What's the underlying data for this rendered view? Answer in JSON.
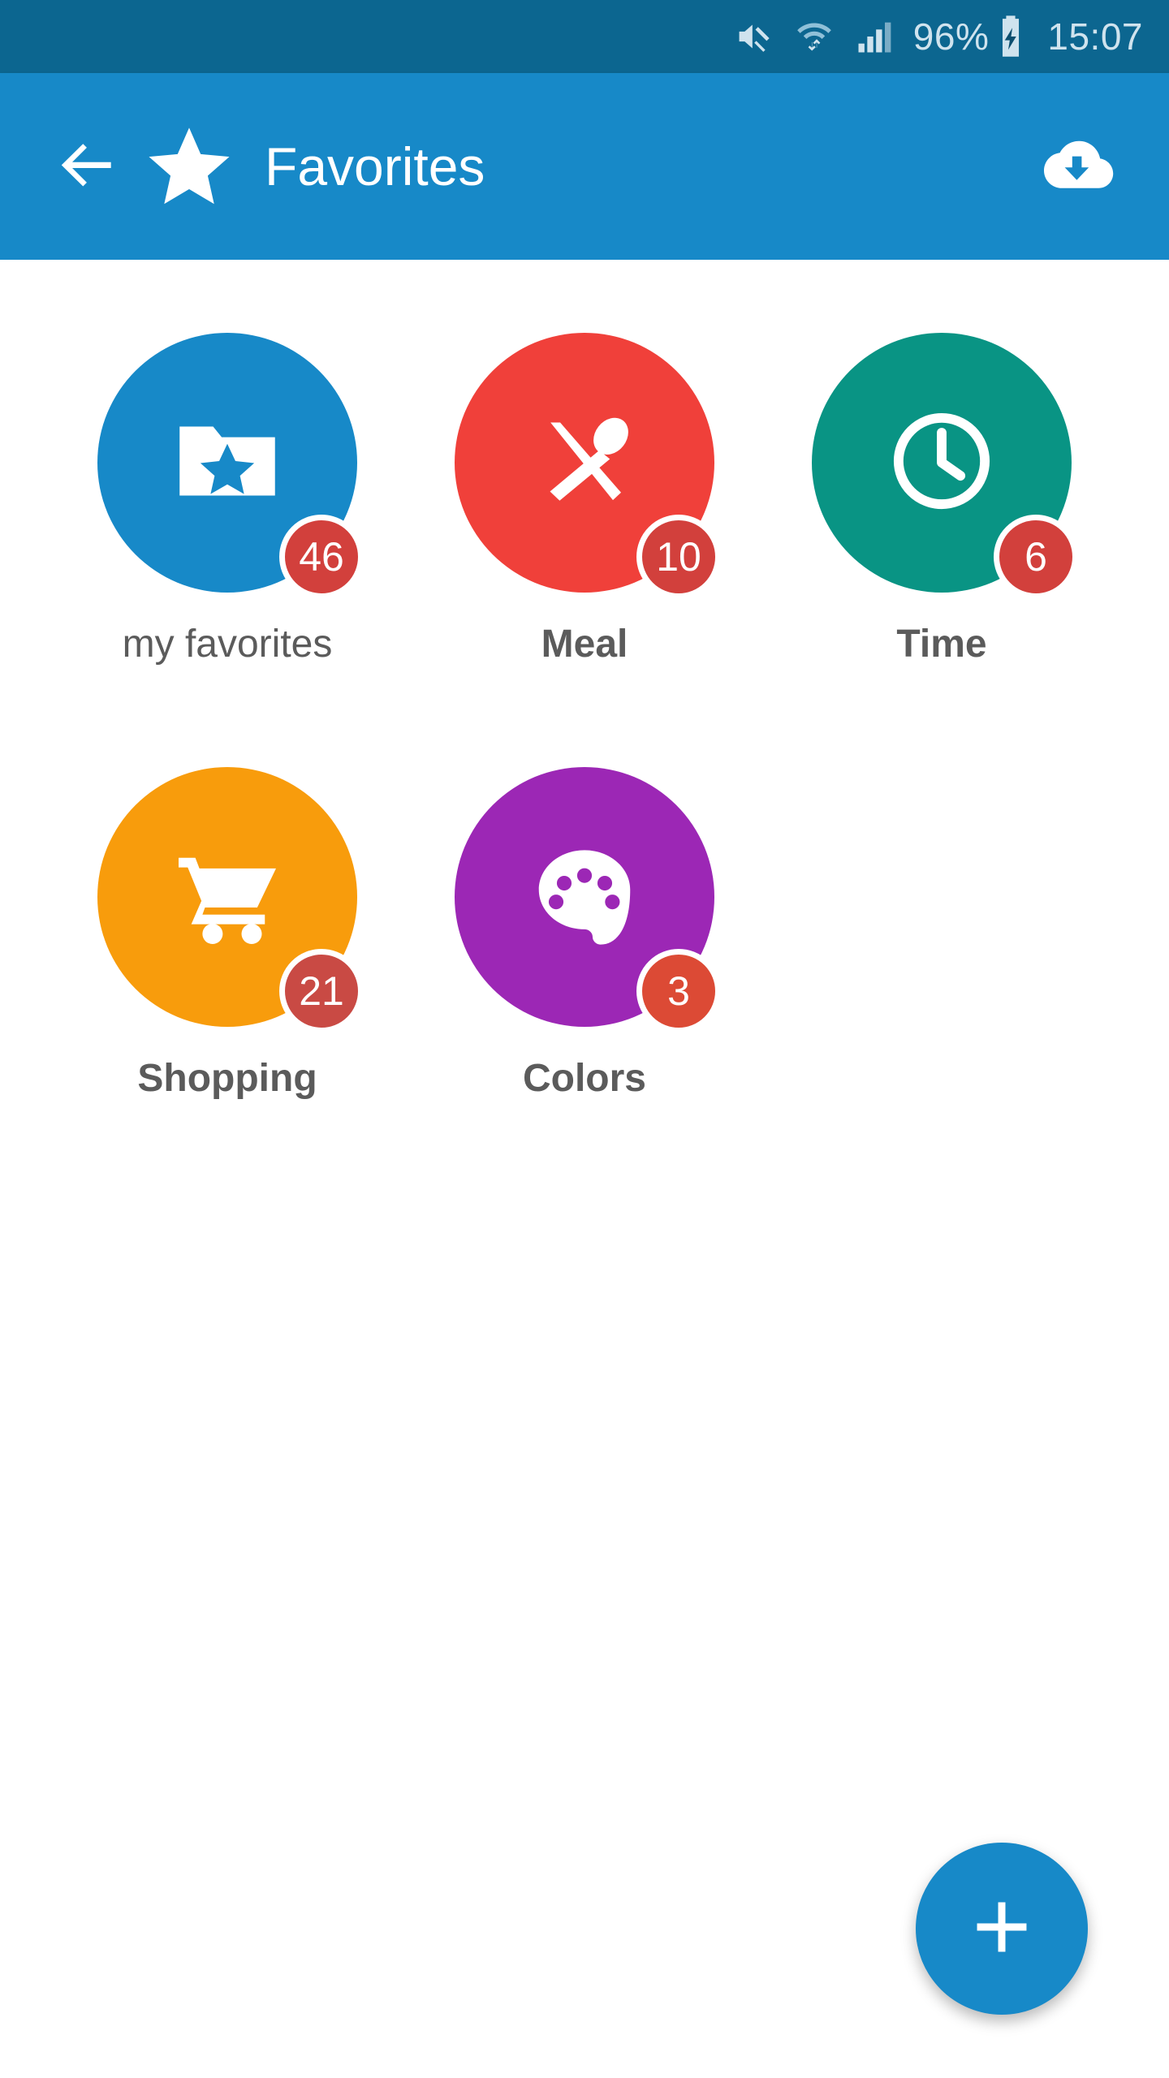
{
  "status_bar": {
    "background": "#0c6690",
    "foreground": "#cfe3ee",
    "battery_percent": "96%",
    "time": "15:07",
    "icons": [
      "mute-icon",
      "wifi-data-icon",
      "signal-bars-icon",
      "battery-charging-icon"
    ]
  },
  "app_bar": {
    "background": "#1789c8",
    "title": "Favorites",
    "back_icon": "back-arrow-icon",
    "brand_icon": "star-icon",
    "action_icon": "cloud-download-icon"
  },
  "content": {
    "categories": [
      {
        "label": "my favorites",
        "count": "46",
        "color": "#1789c8",
        "icon": "folder-star-icon",
        "badge_color": "#d2403c"
      },
      {
        "label": "Meal",
        "count": "10",
        "color": "#f0403a",
        "icon": "knife-spoon-icon",
        "badge_color": "#d2403c"
      },
      {
        "label": "Time",
        "count": "6",
        "color": "#099484",
        "icon": "clock-icon",
        "badge_color": "#d2403c"
      },
      {
        "label": "Shopping",
        "count": "21",
        "color": "#f89c0c",
        "icon": "shopping-cart-icon",
        "badge_color": "#c94a44"
      },
      {
        "label": "Colors",
        "count": "3",
        "color": "#9c27b5",
        "icon": "palette-icon",
        "badge_color": "#dc4a35"
      }
    ]
  },
  "fab": {
    "label": "+",
    "icon": "plus-icon",
    "color": "#1789c8"
  }
}
